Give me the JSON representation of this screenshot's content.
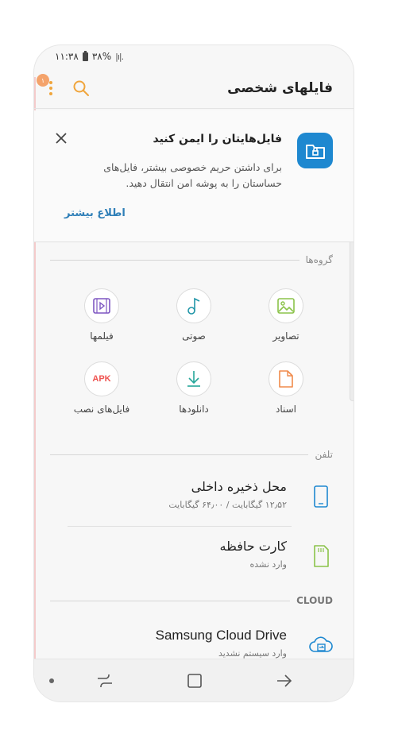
{
  "status_bar": {
    "time": "۱۱:۳۸",
    "battery": "۳۸%",
    "signal": "|ı|."
  },
  "app_bar": {
    "title": "فایلهای شخصی",
    "badge_count": "۱"
  },
  "banner": {
    "title": "فایل‌هایتان را ایمن کنید",
    "text": "برای داشتن حریم خصوصی بیشتر، فایل‌های حساستان را به پوشه امن انتقال دهید.",
    "link": "اطلاع بیشتر"
  },
  "categories": {
    "header": "گروه‌ها",
    "items": [
      {
        "label": "تصاویر",
        "icon": "image-icon",
        "color": "#8bc34a"
      },
      {
        "label": "صوتی",
        "icon": "music-note-icon",
        "color": "#2196a8"
      },
      {
        "label": "فیلمها",
        "icon": "video-icon",
        "color": "#7e57c2"
      },
      {
        "label": "اسناد",
        "icon": "document-icon",
        "color": "#f08a4b"
      },
      {
        "label": "دانلودها",
        "icon": "download-icon",
        "color": "#26a69a"
      },
      {
        "label": "فایل‌های نصب",
        "icon": "apk-icon",
        "color": "#ef5350",
        "glyph": "APK"
      }
    ]
  },
  "phone": {
    "header": "تلفن",
    "internal": {
      "title": "محل ذخیره داخلی",
      "subtitle": "۱۲٫۵۲ گیگابایت / ۶۴٫۰۰ گیگابایت",
      "color": "#1e88d0"
    },
    "sd_card": {
      "title": "کارت حافظه",
      "subtitle": "وارد نشده",
      "color": "#8bc34a"
    }
  },
  "cloud": {
    "header": "CLOUD",
    "samsung": {
      "title": "Samsung Cloud Drive",
      "subtitle": "وارد سیستم نشدید",
      "color": "#1e88d0"
    }
  }
}
